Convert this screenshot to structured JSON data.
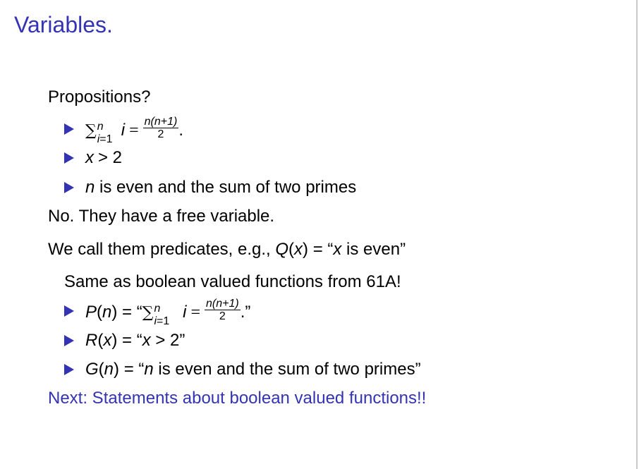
{
  "title": "Variables.",
  "propositions_heading": "Propositions?",
  "bullets_a": [
    {
      "sum_sup": "n",
      "sum_sub": "i=1",
      "lhs_var": "i",
      "frac_num": "n(n+1)",
      "frac_den": "2",
      "tail": "."
    },
    {
      "var": "x",
      "rest": "> 2"
    },
    {
      "var": "n",
      "rest": " is even and the sum of two primes"
    }
  ],
  "no_line": "No. They have a free variable.",
  "call_line": {
    "prefix": "We call them predicates, e.g., ",
    "pred": "Q",
    "arg": "x",
    "eq": " = “",
    "var": "x",
    "rest": " is even”"
  },
  "same_line": "Same as boolean valued functions from 61A!",
  "bullets_b": [
    {
      "pred": "P",
      "arg": "n",
      "sum_sup": "n",
      "sum_sub": "i=1",
      "lhs_var": "i",
      "frac_num": "n(n+1)",
      "frac_den": "2",
      "tail": ".”"
    },
    {
      "pred": "R",
      "arg": "x",
      "var": "x",
      "rest": " > 2”"
    },
    {
      "pred": "G",
      "arg": "n",
      "var": "n",
      "rest": " is even and the sum of two primes”"
    }
  ],
  "next_line": "Next: Statements about boolean valued functions!!",
  "colors": {
    "accent": "#3333b3"
  }
}
